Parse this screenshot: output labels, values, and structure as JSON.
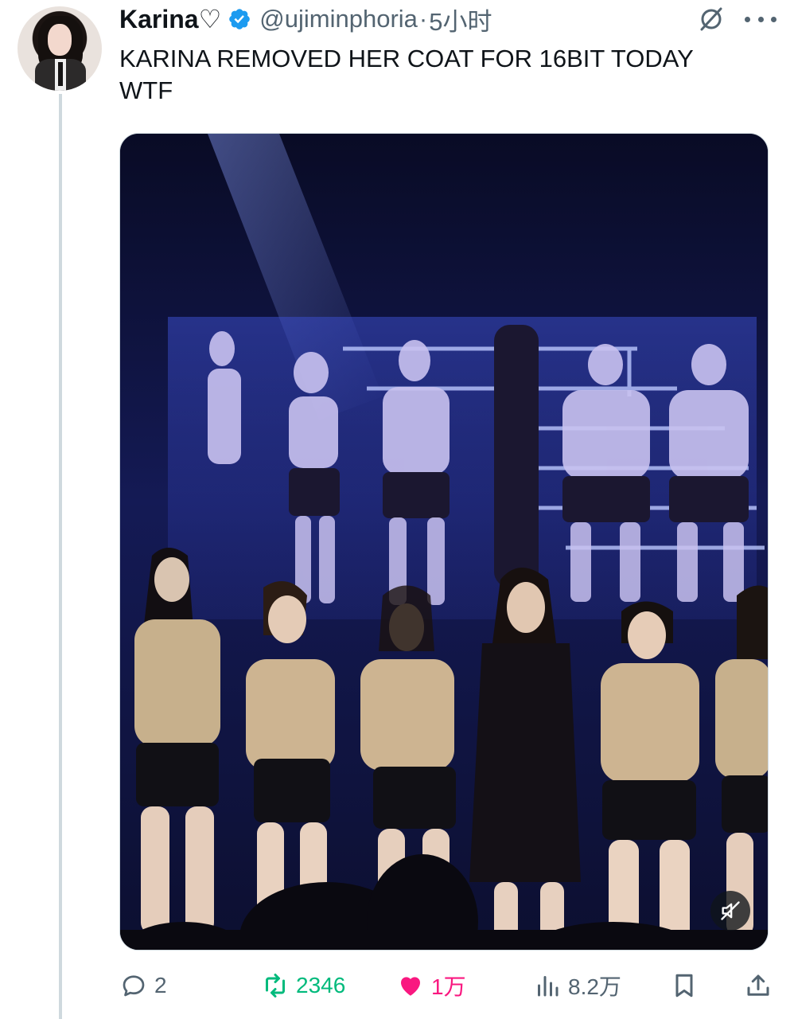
{
  "author": {
    "display_name": "Karina♡",
    "handle": "@ujiminphoria",
    "separator": "·",
    "time": "5小时"
  },
  "tweet": {
    "text": "KARINA REMOVED HER COAT FOR 16BIT TODAY\nWTF"
  },
  "media": {
    "type": "video",
    "mute_icon": "speaker-muted-icon"
  },
  "actions": {
    "reply_count": "2",
    "retweet_count": "2346",
    "like_count": "1万",
    "view_count": "8.2万"
  },
  "colors": {
    "verified": "#1d9bf0",
    "retweet_active": "#00ba7c",
    "like_active": "#f91880",
    "muted_text": "#536471"
  },
  "icons": {
    "reply": "comment-bubble-icon",
    "retweet": "retweet-icon",
    "like": "heart-filled-icon",
    "views": "bar-chart-icon",
    "bookmark": "bookmark-icon",
    "share": "share-icon",
    "grok": "grok-icon",
    "more": "more-dots-icon",
    "verified": "verified-badge-icon"
  }
}
